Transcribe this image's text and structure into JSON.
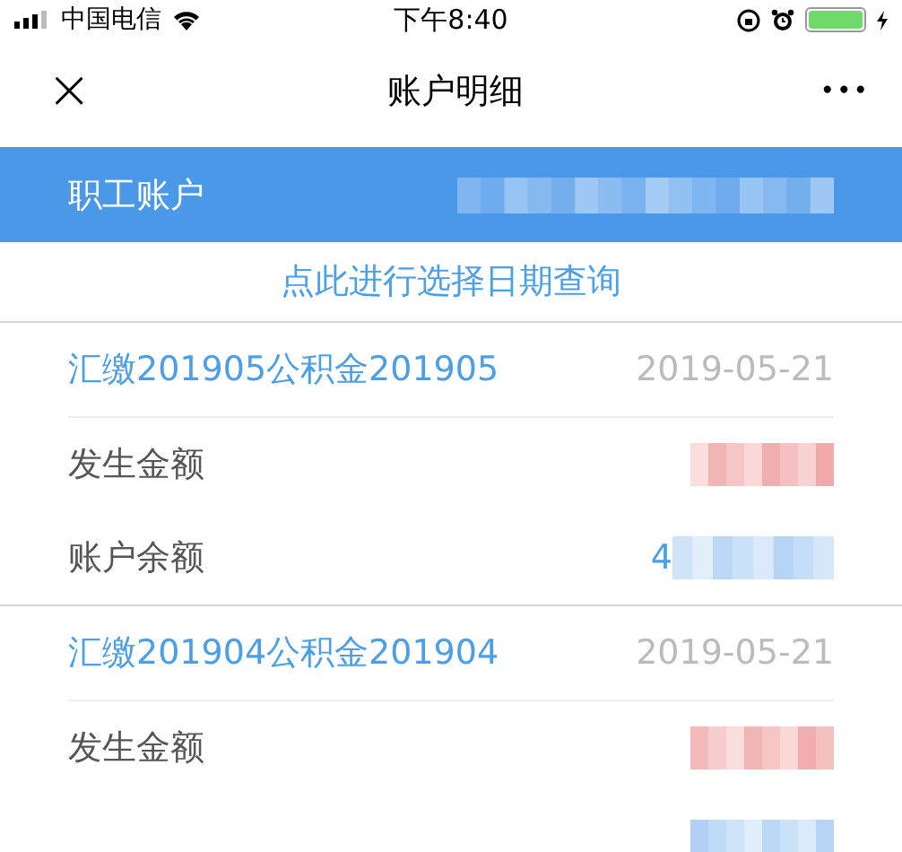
{
  "status_bar": {
    "carrier": "中国电信",
    "time": "下午8:40"
  },
  "nav": {
    "close": "×",
    "title": "账户明细",
    "more": "•••"
  },
  "account": {
    "label": "职工账户"
  },
  "query_link": "点此进行选择日期查询",
  "entries": [
    {
      "title": "汇缴201905公积金201905",
      "date": "2019-05-21",
      "rows": [
        {
          "label": "发生金额",
          "color": "#f0a0a0",
          "prefix": ""
        },
        {
          "label": "账户余额",
          "color": "#a8cdf4",
          "prefix": "4"
        }
      ]
    },
    {
      "title": "汇缴201904公积金201904",
      "date": "2019-05-21",
      "rows": [
        {
          "label": "发生金额",
          "color": "#f0a0a0",
          "prefix": ""
        },
        {
          "color": "#a8cdf4",
          "prefix": ""
        }
      ]
    }
  ]
}
